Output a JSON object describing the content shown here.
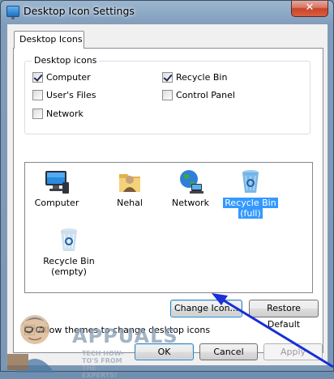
{
  "window": {
    "title": "Desktop Icon Settings",
    "close_glyph": "✕"
  },
  "tabs": [
    {
      "label": "Desktop Icons",
      "active": true
    }
  ],
  "desktop_icons_group": {
    "label": "Desktop icons",
    "checkboxes": [
      {
        "label": "Computer",
        "checked": true
      },
      {
        "label": "Recycle Bin",
        "checked": true
      },
      {
        "label": "User's Files",
        "checked": false
      },
      {
        "label": "Control Panel",
        "checked": false
      },
      {
        "label": "Network",
        "checked": false
      }
    ]
  },
  "icon_list": [
    {
      "label": "Computer",
      "icon": "computer-icon",
      "selected": false
    },
    {
      "label": "Nehal",
      "icon": "user-folder-icon",
      "selected": false
    },
    {
      "label": "Network",
      "icon": "network-globe-icon",
      "selected": false
    },
    {
      "label": "Recycle Bin\n(full)",
      "line1": "Recycle Bin",
      "line2": "(full)",
      "icon": "recycle-bin-full-icon",
      "selected": true
    },
    {
      "label": "Recycle Bin\n(empty)",
      "line1": "Recycle Bin",
      "line2": "(empty)",
      "icon": "recycle-bin-empty-icon",
      "selected": false
    }
  ],
  "buttons": {
    "change_icon": "Change Icon...",
    "restore_default": "Restore Default",
    "ok": "OK",
    "cancel": "Cancel",
    "apply": "Apply"
  },
  "allow_themes": {
    "label": "Allow themes to change desktop icons",
    "checked": true
  },
  "watermark": {
    "brand": "APPUALS",
    "tagline": "TECH HOW-TO'S FROM THE EXPERTS!"
  },
  "colors": {
    "selection": "#3399ff",
    "annotation_arrow": "#1a2fd6",
    "close_button": "#c7442c"
  }
}
